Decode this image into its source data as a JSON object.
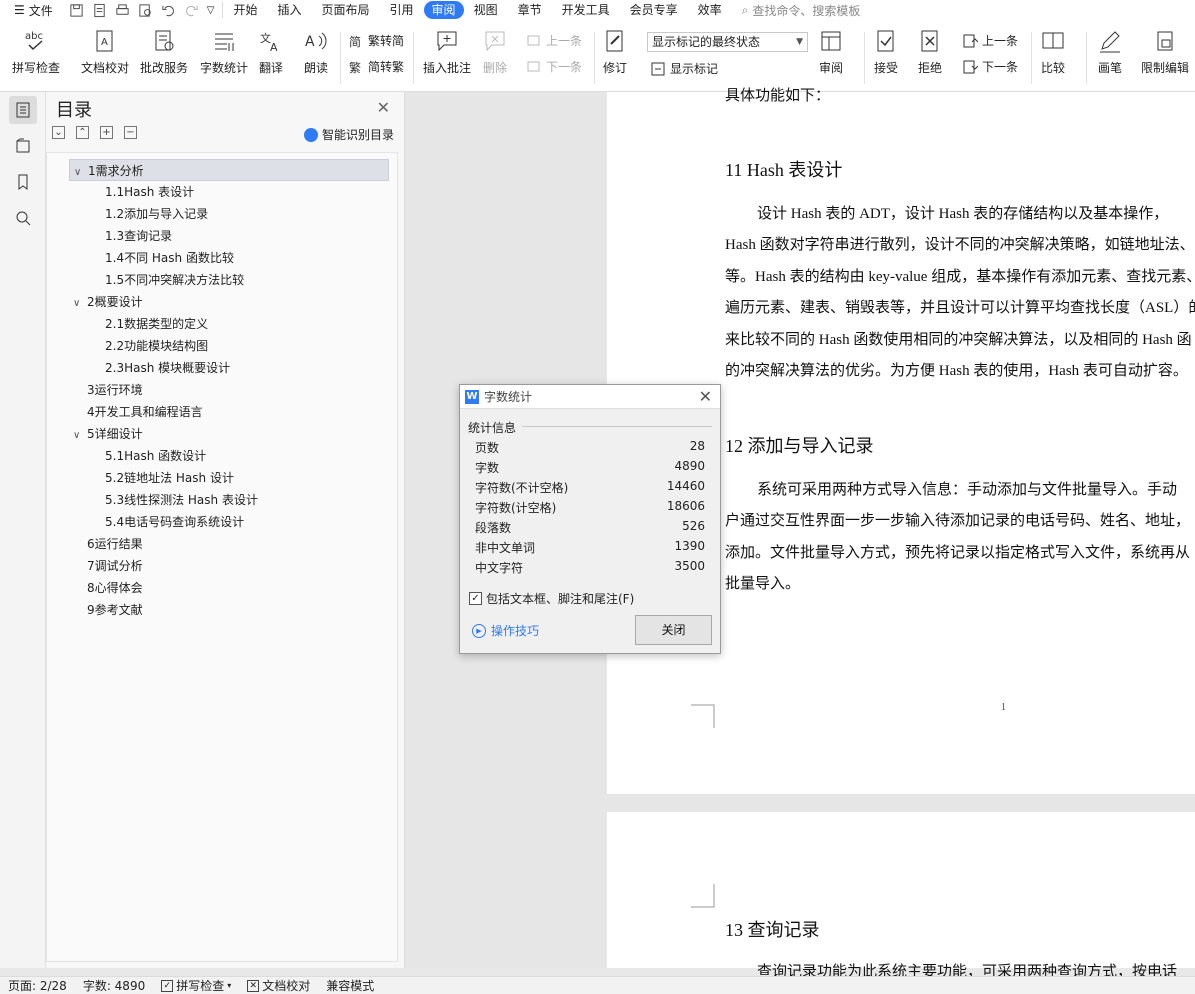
{
  "menubar": {
    "file_label": "文件",
    "tabs": [
      "开始",
      "插入",
      "页面布局",
      "引用",
      "审阅",
      "视图",
      "章节",
      "开发工具",
      "会员专享",
      "效率"
    ],
    "active_tab": "审阅",
    "search_placeholder": "查找命令、搜索模板"
  },
  "ribbon": {
    "spell_check": "拼写检查",
    "doc_proof": "文档校对",
    "revise_service": "批改服务",
    "word_count": "字数统计",
    "translate": "翻译",
    "read_aloud": "朗读",
    "trad_to_simp": "繁转简",
    "simp_to_trad": "简转繁",
    "insert_comment": "插入批注",
    "delete": "删除",
    "prev_comment": "上一条",
    "next_comment": "下一条",
    "track_changes": "修订",
    "markup_select": "显示标记的最终状态",
    "show_markup": "显示标记",
    "review": "审阅",
    "accept": "接受",
    "reject": "拒绝",
    "prev_change": "上一条",
    "next_change": "下一条",
    "compare": "比较",
    "pen": "画笔",
    "restrict_edit": "限制编辑"
  },
  "toc": {
    "title": "目录",
    "smart_label": "智能识别目录",
    "items": [
      {
        "label": "1需求分析",
        "level": 1,
        "expanded": true,
        "selected": true
      },
      {
        "label": "1.1Hash 表设计",
        "level": 2
      },
      {
        "label": "1.2添加与导入记录",
        "level": 2
      },
      {
        "label": "1.3查询记录",
        "level": 2
      },
      {
        "label": "1.4不同 Hash 函数比较",
        "level": 2
      },
      {
        "label": "1.5不同冲突解决方法比较",
        "level": 2
      },
      {
        "label": "2概要设计",
        "level": 1,
        "expanded": true
      },
      {
        "label": "2.1数据类型的定义",
        "level": 2
      },
      {
        "label": "2.2功能模块结构图",
        "level": 2
      },
      {
        "label": "2.3Hash 模块概要设计",
        "level": 2
      },
      {
        "label": "3运行环境",
        "level": 1
      },
      {
        "label": "4开发工具和编程语言",
        "level": 1
      },
      {
        "label": "5详细设计",
        "level": 1,
        "expanded": true
      },
      {
        "label": "5.1Hash 函数设计",
        "level": 2
      },
      {
        "label": "5.2链地址法 Hash 设计",
        "level": 2
      },
      {
        "label": "5.3线性探测法 Hash 表设计",
        "level": 2
      },
      {
        "label": "5.4电话号码查询系统设计",
        "level": 2
      },
      {
        "label": "6运行结果",
        "level": 1
      },
      {
        "label": "7调试分析",
        "level": 1
      },
      {
        "label": "8心得体会",
        "level": 1
      },
      {
        "label": "9参考文献",
        "level": 1
      }
    ]
  },
  "doc": {
    "top_fragment": "具体功能如下：",
    "h11": "11  Hash 表设计",
    "p11": [
      "设计 Hash 表的 ADT，设计 Hash 表的存储结构以及基本操作，",
      "Hash 函数对字符串进行散列，设计不同的冲突解决策略，如链地址法、",
      "等。Hash 表的结构由 key-value 组成，基本操作有添加元素、查找元素、",
      "遍历元素、建表、销毁表等，并且设计可以计算平均查找长度（ASL）的",
      "来比较不同的 Hash 函数使用相同的冲突解决算法，以及相同的 Hash 函",
      "的冲突解决算法的优劣。为方便 Hash 表的使用，Hash 表可自动扩容。"
    ],
    "h12": "12  添加与导入记录",
    "p12": [
      "系统可采用两种方式导入信息：手动添加与文件批量导入。手动",
      "户通过交互性界面一步一步输入待添加记录的电话号码、姓名、地址，",
      "添加。文件批量导入方式，预先将记录以指定格式写入文件，系统再从",
      "批量导入。"
    ],
    "page_number": "1",
    "h13": "13  查询记录",
    "p13_fragment": "查询记录功能为此系统主要功能，可采用两种查询方式，按电话"
  },
  "dialog": {
    "title": "字数统计",
    "group": "统计信息",
    "rows": [
      {
        "label": "页数",
        "value": "28"
      },
      {
        "label": "字数",
        "value": "4890"
      },
      {
        "label": "字符数(不计空格)",
        "value": "14460"
      },
      {
        "label": "字符数(计空格)",
        "value": "18606"
      },
      {
        "label": "段落数",
        "value": "526"
      },
      {
        "label": "非中文单词",
        "value": "1390"
      },
      {
        "label": "中文字符",
        "value": "3500"
      }
    ],
    "checkbox_label": "包括文本框、脚注和尾注(F)",
    "checkbox_checked": true,
    "tips": "操作技巧",
    "close": "关闭"
  },
  "status": {
    "page": "页面: 2/28",
    "words": "字数: 4890",
    "spell": "拼写检查",
    "proof": "文档校对",
    "compat": "兼容模式"
  },
  "colors": {
    "accent": "#2f7bf5"
  }
}
